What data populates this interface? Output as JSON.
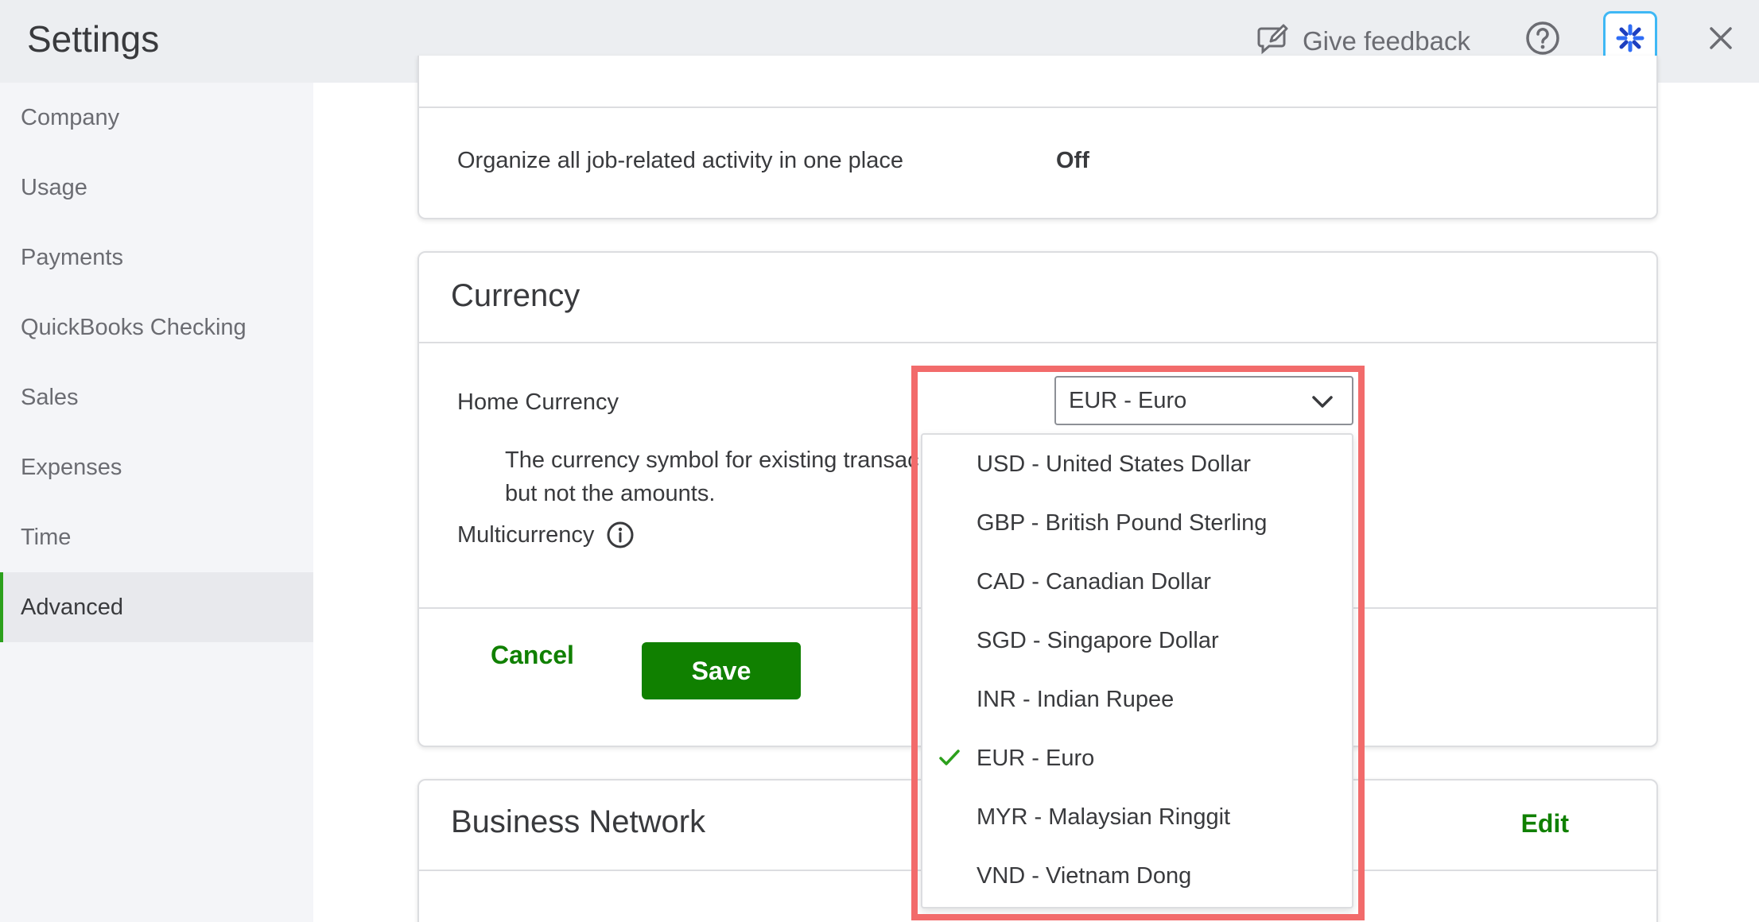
{
  "header": {
    "title": "Settings",
    "feedback_label": "Give feedback"
  },
  "sidebar": {
    "items": [
      {
        "label": "Company"
      },
      {
        "label": "Usage"
      },
      {
        "label": "Payments"
      },
      {
        "label": "QuickBooks Checking"
      },
      {
        "label": "Sales"
      },
      {
        "label": "Expenses"
      },
      {
        "label": "Time"
      },
      {
        "label": "Advanced"
      }
    ],
    "active": "Advanced"
  },
  "projects": {
    "row_label": "Organize all job-related activity in one place",
    "row_value": "Off"
  },
  "currency": {
    "title": "Currency",
    "home_currency_label": "Home Currency",
    "note_line1": "The currency symbol for existing transac",
    "note_line2": "but not the amounts.",
    "multicurrency_label": "Multicurrency",
    "selected": "EUR - Euro",
    "options": [
      "USD - United States Dollar",
      "GBP - British Pound Sterling",
      "CAD - Canadian Dollar",
      "SGD - Singapore Dollar",
      "INR - Indian Rupee",
      "EUR - Euro",
      "MYR - Malaysian Ringgit",
      "VND - Vietnam Dong"
    ],
    "cancel_label": "Cancel",
    "save_label": "Save"
  },
  "business_network": {
    "title": "Business Network",
    "edit_label": "Edit"
  },
  "colors": {
    "brand_green": "#108000",
    "check_green": "#2ca01c",
    "highlight": "#f26b6b",
    "ai_border": "#3fb8f5"
  }
}
